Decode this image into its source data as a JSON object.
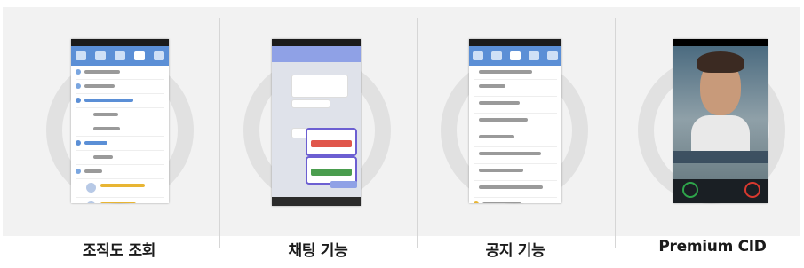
{
  "features": [
    {
      "id": "org",
      "caption": "조직도 조회"
    },
    {
      "id": "chat",
      "caption": "채팅 기능"
    },
    {
      "id": "notice",
      "caption": "공지 기능"
    },
    {
      "id": "cid",
      "caption": "Premium CID"
    }
  ],
  "icons": {
    "phone": "phone-screenshot-icon",
    "ring": "circle-decoration-icon"
  },
  "colors": {
    "accent_blue": "#5b8fd6",
    "chat_header": "#8fa1e6",
    "highlight": "#6c5fd2",
    "ring": "#e1e1e1",
    "call_green": "#2ea54a",
    "call_red": "#d9392f"
  }
}
